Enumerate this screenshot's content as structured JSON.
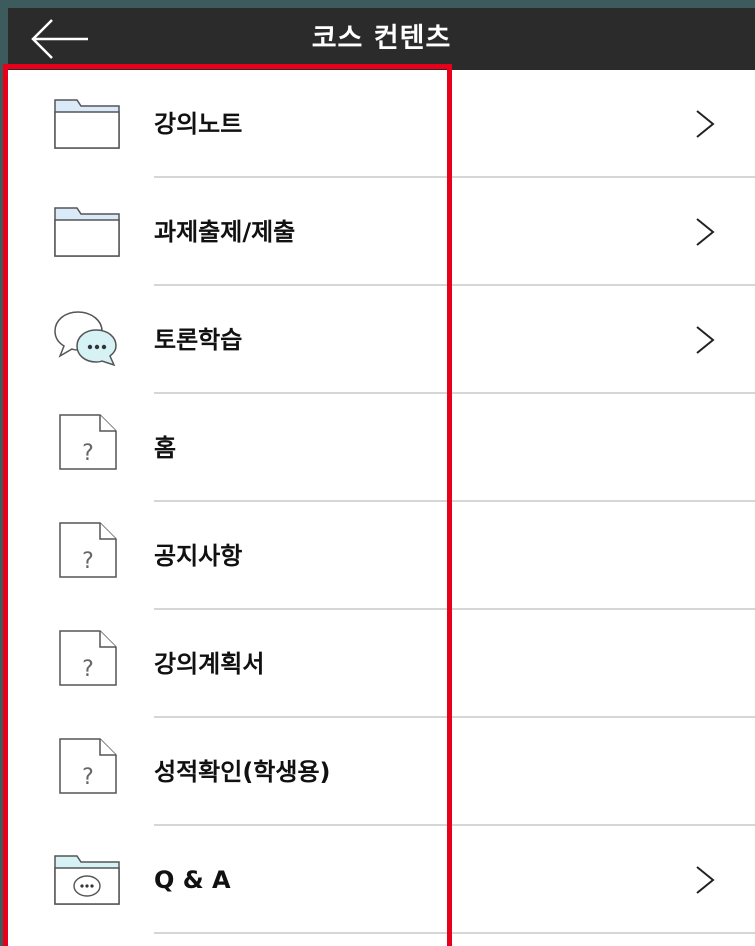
{
  "header": {
    "title": "코스 컨텐츠",
    "back_icon": "back-arrow-icon"
  },
  "menu": {
    "items": [
      {
        "label": "강의노트",
        "icon": "folder-icon",
        "has_chevron": true
      },
      {
        "label": "과제출제/제출",
        "icon": "folder-icon",
        "has_chevron": true
      },
      {
        "label": "토론학습",
        "icon": "chat-bubbles-icon",
        "has_chevron": true
      },
      {
        "label": "홈",
        "icon": "unknown-file-icon",
        "has_chevron": false
      },
      {
        "label": "공지사항",
        "icon": "unknown-file-icon",
        "has_chevron": false
      },
      {
        "label": "강의계획서",
        "icon": "unknown-file-icon",
        "has_chevron": false
      },
      {
        "label": "성적확인(학생용)",
        "icon": "unknown-file-icon",
        "has_chevron": false
      },
      {
        "label": "Q & A",
        "icon": "chat-folder-icon",
        "has_chevron": true
      }
    ]
  },
  "colors": {
    "header_bg": "#2b2b2b",
    "outer_bg": "#3d5a5c",
    "highlight": "#e8001b",
    "folder_fill": "#dbeaf8",
    "chat_fill": "#d6f2f4"
  }
}
